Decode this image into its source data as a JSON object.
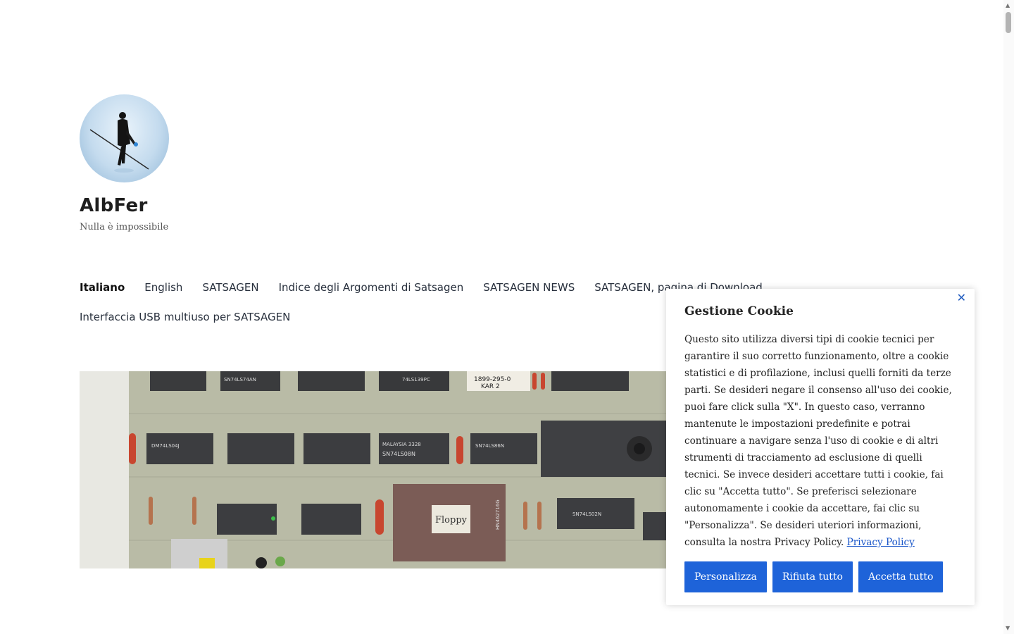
{
  "site": {
    "title": "AlbFer",
    "tagline": "Nulla è impossibile"
  },
  "nav": {
    "row1": [
      "Italiano",
      "English",
      "SATSAGEN",
      "Indice degli Argomenti di Satsagen",
      "SATSAGEN NEWS",
      "SATSAGEN, pagina di Download"
    ],
    "row2": [
      "Interfaccia USB multiuso per SATSAGEN"
    ],
    "active": "Italiano"
  },
  "banner": {
    "chip_labels": [
      "SN74LS74AN",
      "74LS139PC",
      "1899-295-0",
      "KAR 2",
      "DM74LS04J",
      "MALAYSIA 3328",
      "SN74LS08N",
      "SN74LS86N",
      "Floppy",
      "HN462716G",
      "SN74LS02N"
    ]
  },
  "cookie": {
    "close_icon": "close-icon",
    "title": "Gestione Cookie",
    "text": "Questo sito utilizza diversi tipi di cookie tecnici per garantire il suo corretto funzionamento, oltre a cookie statistici e di profilazione, inclusi quelli forniti da terze parti. Se desideri negare il consenso all'uso dei cookie, puoi fare click sulla \"X\". In questo caso, verranno mantenute le impostazioni predefinite e potrai continuare a navigare senza l'uso di cookie e di altri strumenti di tracciamento ad esclusione di quelli tecnici. Se invece desideri accettare tutti i cookie, fai clic su \"Accetta tutto\". Se preferisci selezionare autonomamente i cookie da accettare, fai clic su \"Personalizza\". Se desideri uteriori informazioni, consulta la nostra Privacy Policy.",
    "link": "Privacy Policy",
    "buttons": {
      "customize": "Personalizza",
      "reject": "Rifiuta tutto",
      "accept": "Accetta tutto"
    },
    "accent_color": "#1e63d9"
  }
}
